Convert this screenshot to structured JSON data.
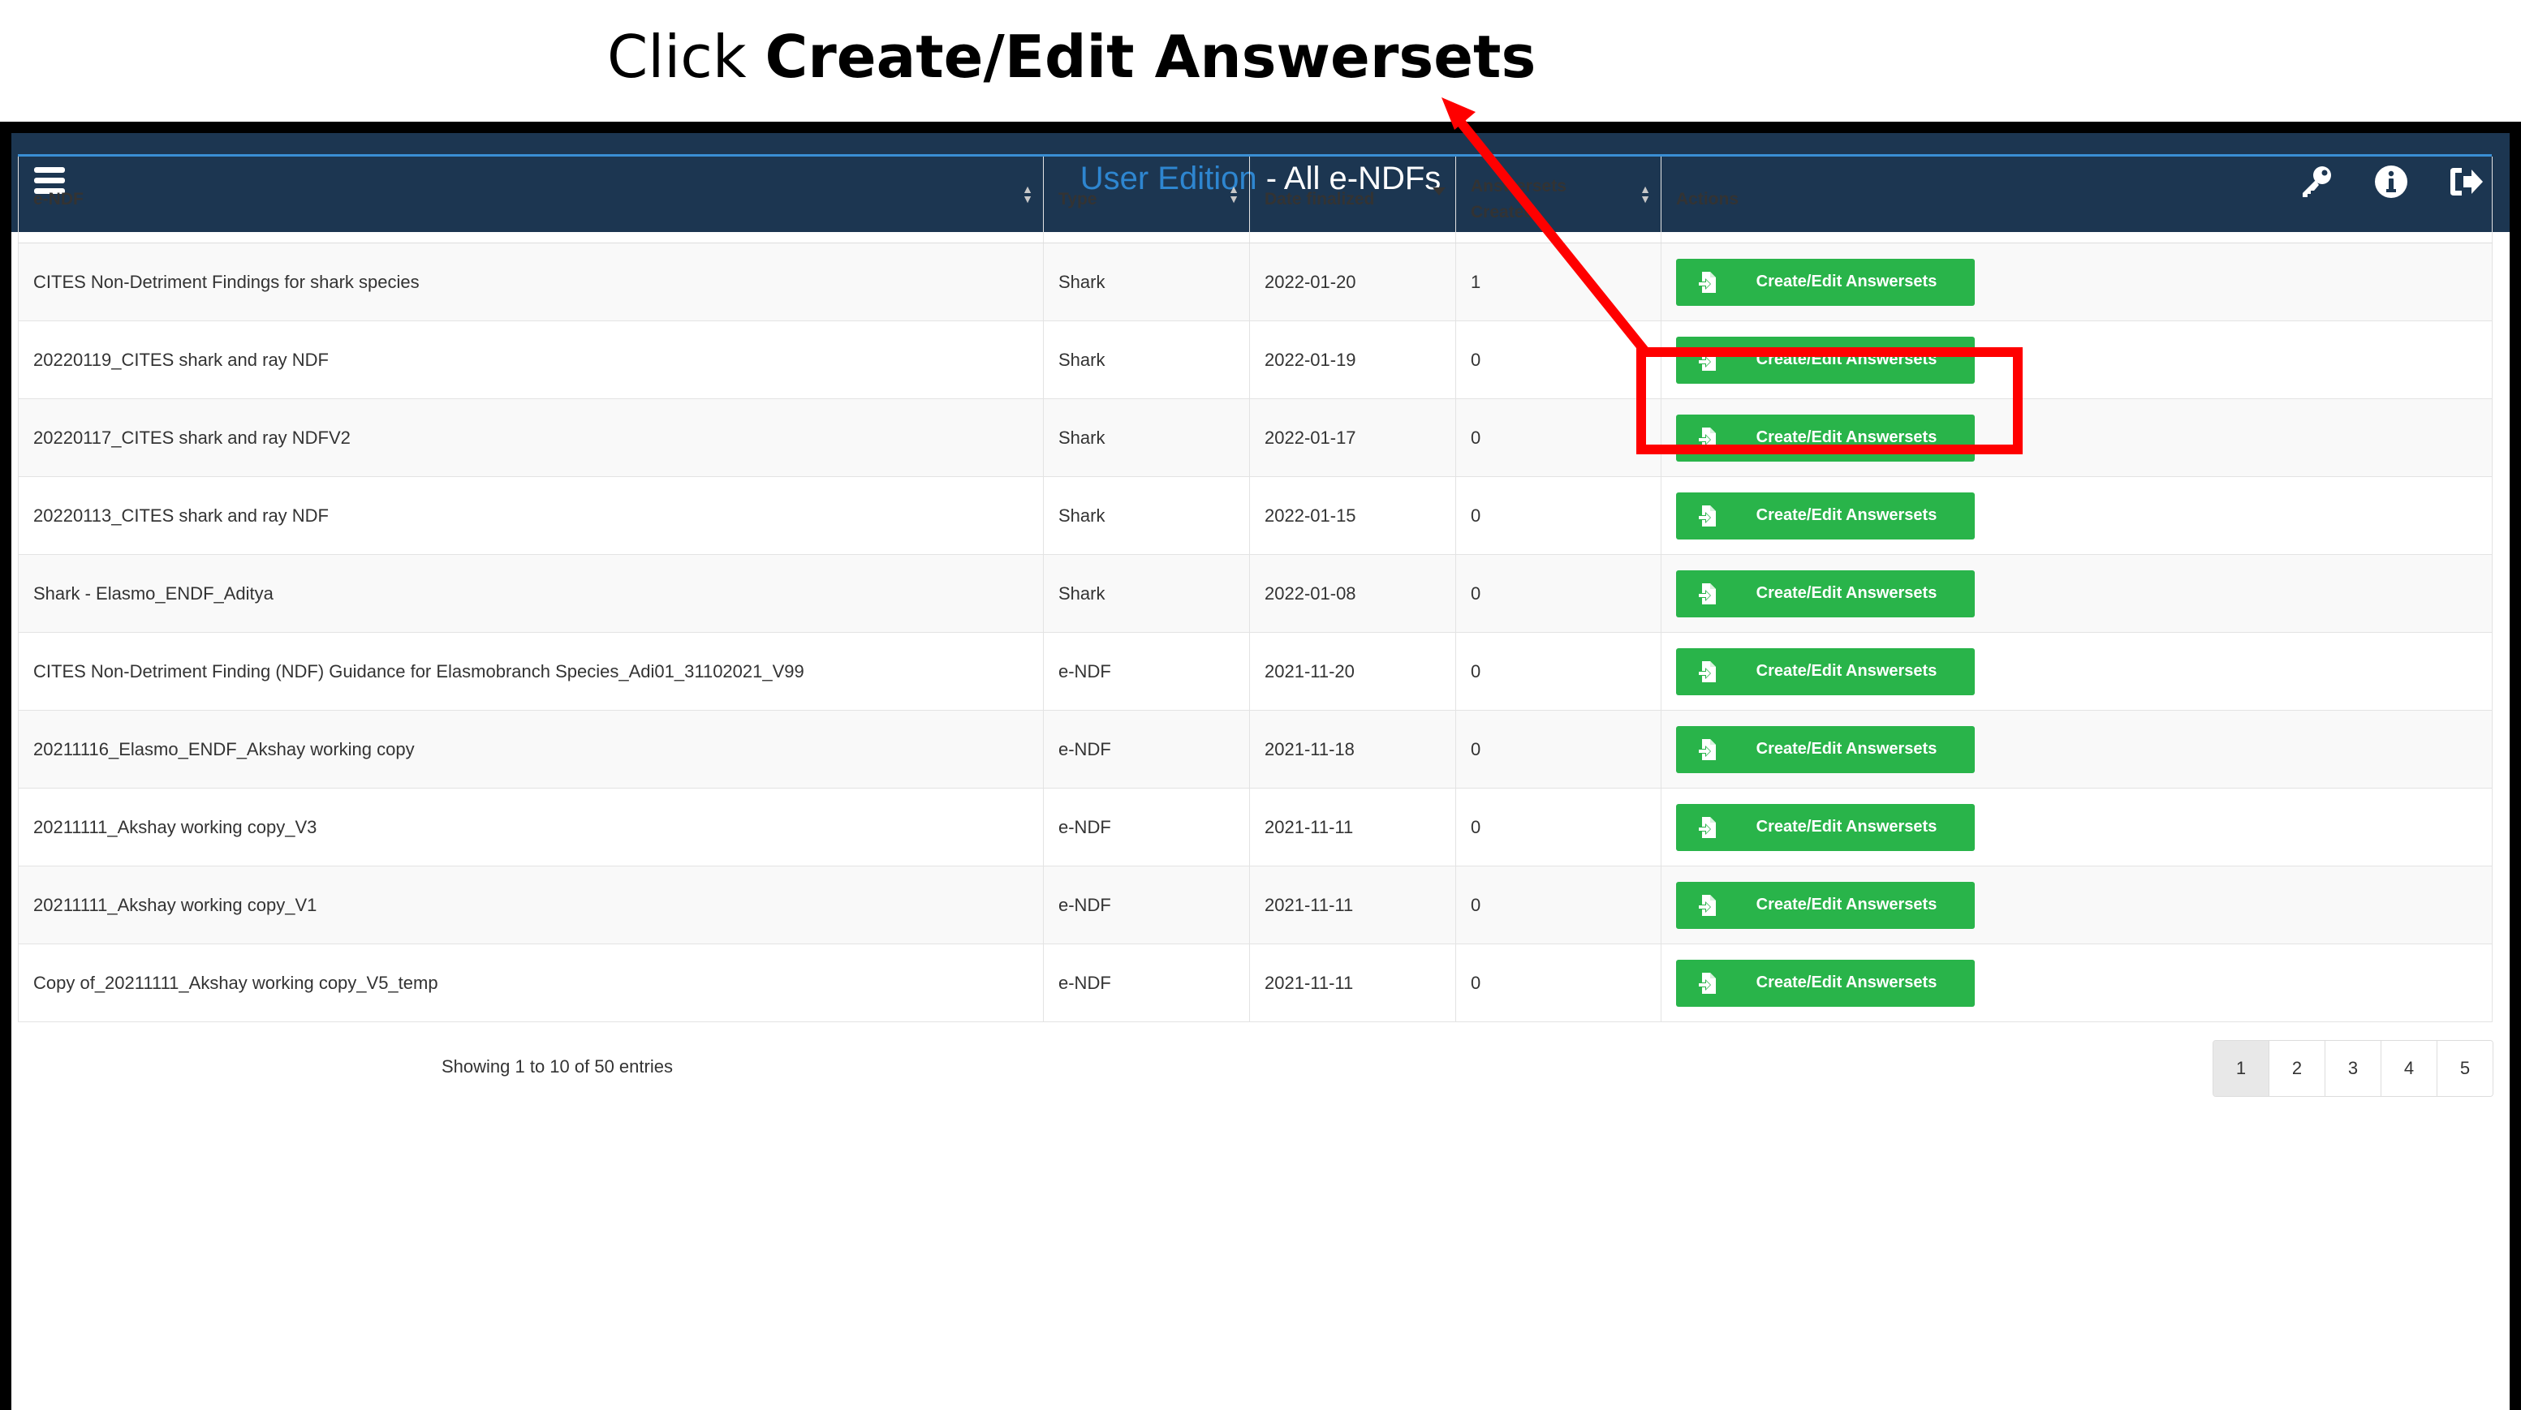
{
  "instruction": {
    "prefix": "Click ",
    "emphasis": "Create/Edit Answersets"
  },
  "header": {
    "title_highlight": "User Edition",
    "title_rest": " - All e-NDFs",
    "icons": [
      "key-icon",
      "info-icon",
      "logout-icon"
    ],
    "bg_color": "#1c3651",
    "highlight_color": "#2e86d0"
  },
  "table": {
    "columns": [
      "e-NDF",
      "Type",
      "Date finalized",
      "Answersets Created",
      "Actions"
    ],
    "rows": [
      {
        "name": "CITES Non-Detriment Findings for shark species",
        "type": "Shark",
        "date": "2022-01-20",
        "count": "1",
        "action": "Create/Edit Answersets"
      },
      {
        "name": "20220119_CITES shark and ray NDF",
        "type": "Shark",
        "date": "2022-01-19",
        "count": "0",
        "action": "Create/Edit Answersets"
      },
      {
        "name": "20220117_CITES shark and ray NDFV2",
        "type": "Shark",
        "date": "2022-01-17",
        "count": "0",
        "action": "Create/Edit Answersets"
      },
      {
        "name": "20220113_CITES shark and ray NDF",
        "type": "Shark",
        "date": "2022-01-15",
        "count": "0",
        "action": "Create/Edit Answersets"
      },
      {
        "name": "Shark - Elasmo_ENDF_Aditya",
        "type": "Shark",
        "date": "2022-01-08",
        "count": "0",
        "action": "Create/Edit Answersets"
      },
      {
        "name": "CITES Non-Detriment Finding (NDF) Guidance for Elasmobranch Species_Adi01_31102021_V99",
        "type": "e-NDF",
        "date": "2021-11-20",
        "count": "0",
        "action": "Create/Edit Answersets"
      },
      {
        "name": "20211116_Elasmo_ENDF_Akshay working copy",
        "type": "e-NDF",
        "date": "2021-11-18",
        "count": "0",
        "action": "Create/Edit Answersets"
      },
      {
        "name": "20211111_Akshay working copy_V3",
        "type": "e-NDF",
        "date": "2021-11-11",
        "count": "0",
        "action": "Create/Edit Answersets"
      },
      {
        "name": "20211111_Akshay working copy_V1",
        "type": "e-NDF",
        "date": "2021-11-11",
        "count": "0",
        "action": "Create/Edit Answersets"
      },
      {
        "name": "Copy of_20211111_Akshay working copy_V5_temp",
        "type": "e-NDF",
        "date": "2021-11-11",
        "count": "0",
        "action": "Create/Edit Answersets"
      }
    ],
    "button_color": "#29b44a"
  },
  "footer": {
    "info": "Showing 1 to 10 of 50 entries",
    "pages": [
      "1",
      "2",
      "3",
      "4",
      "5"
    ],
    "active_page": "1"
  },
  "annotation": {
    "color": "#ff0000"
  }
}
